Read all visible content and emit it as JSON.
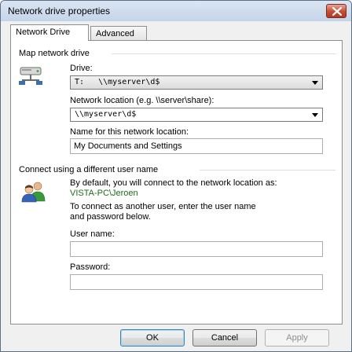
{
  "window": {
    "title": "Network drive properties"
  },
  "tabs": [
    {
      "label": "Network Drive",
      "active": true
    },
    {
      "label": "Advanced",
      "active": false
    }
  ],
  "map_section": {
    "title": "Map network drive",
    "drive_label": "Drive:",
    "drive_letter": "T:",
    "drive_path": "\\\\myserver\\d$",
    "location_label": "Network location (e.g. \\\\server\\share):",
    "location_value": "\\\\myserver\\d$",
    "name_label": "Name for this network location:",
    "name_value": "My Documents and Settings"
  },
  "user_section": {
    "title": "Connect using a different user name",
    "default_text": "By default, you will connect to the network location as:",
    "default_user": "VISTA-PC\\Jeroen",
    "instructions_line1": "To connect as another user, enter the user name",
    "instructions_line2": "and password below.",
    "username_label": "User name:",
    "username_value": "",
    "password_label": "Password:",
    "password_value": ""
  },
  "buttons": {
    "ok": "OK",
    "cancel": "Cancel",
    "apply": "Apply"
  },
  "colors": {
    "accent": "#3c7fb1",
    "user_text": "#1d6a1d"
  },
  "icons": [
    "close-icon",
    "network-drive-icon",
    "users-icon",
    "chevron-down-icon"
  ]
}
